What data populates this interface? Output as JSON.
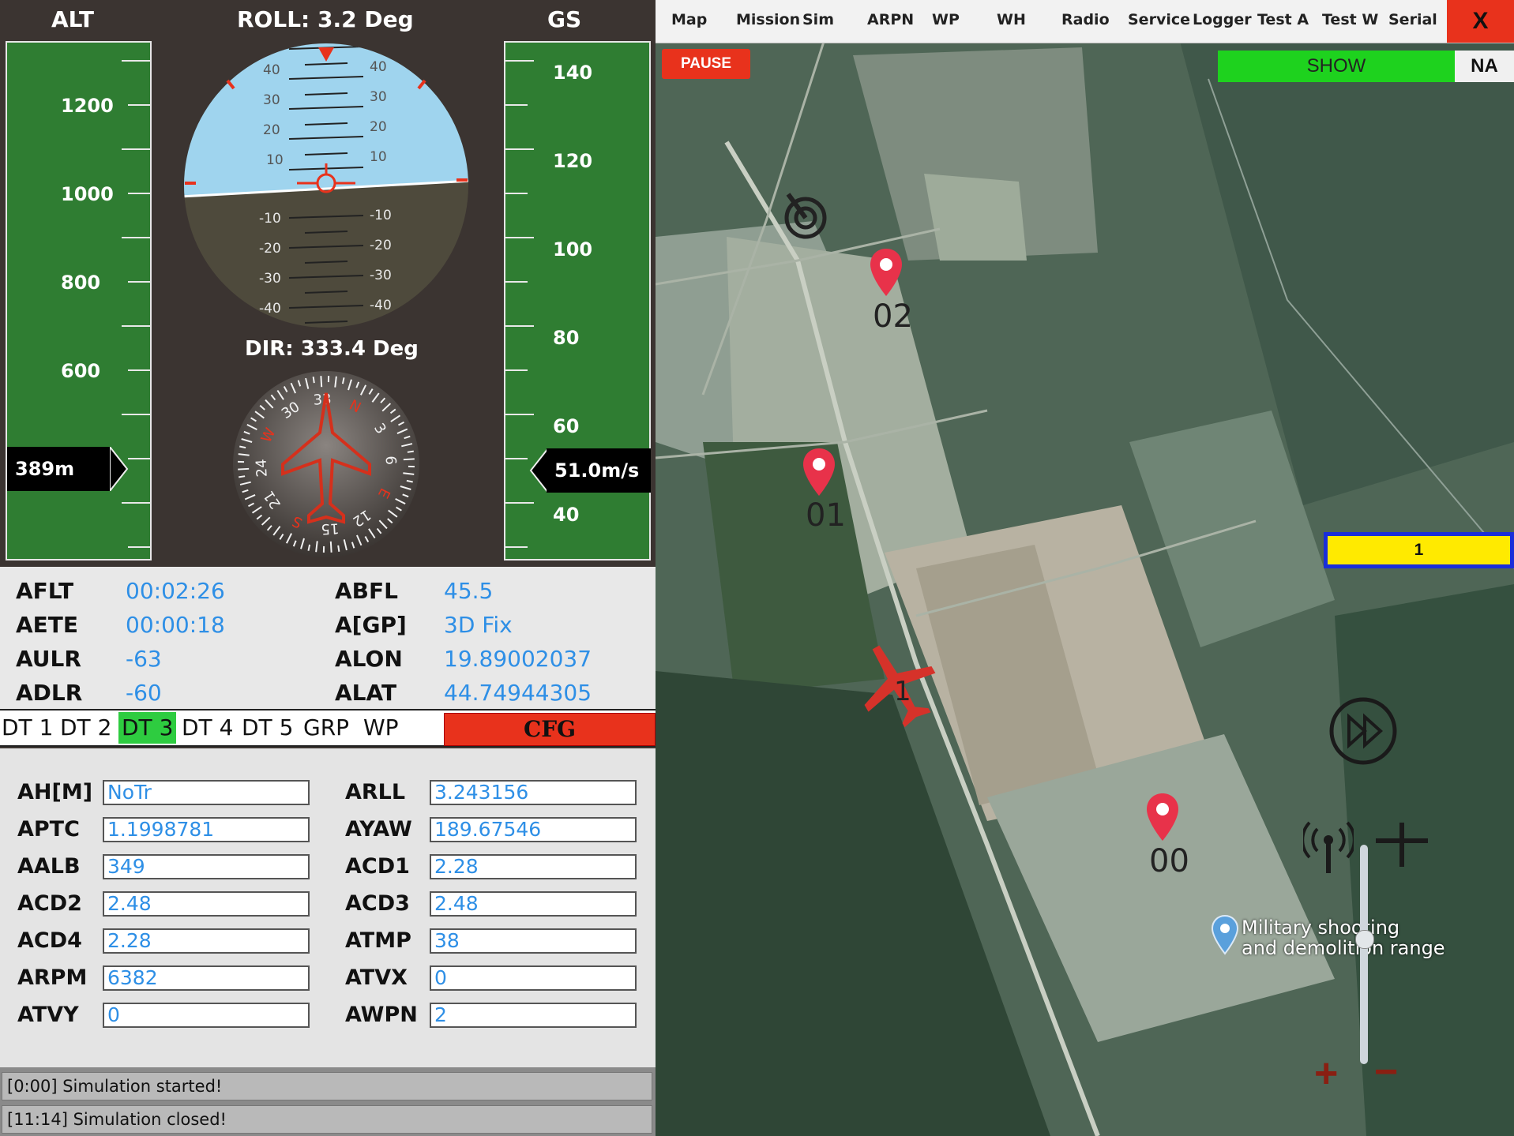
{
  "instruments": {
    "alt_header": "ALT",
    "roll": "ROLL: 3.2 Deg",
    "gs_header": "GS",
    "dir": "DIR: 333.4 Deg",
    "alt_ticks": [
      "1200",
      "1000",
      "800",
      "600"
    ],
    "alt_readout": "389m",
    "gs_ticks": [
      "140",
      "120",
      "100",
      "80",
      "60",
      "40"
    ],
    "gs_readout": "51.0m/s",
    "pitch_up": [
      "40",
      "30",
      "20",
      "10"
    ],
    "pitch_down": [
      "-10",
      "-20",
      "-30",
      "-40"
    ],
    "compass_marks": [
      "N",
      "3",
      "6",
      "E",
      "12",
      "15",
      "S",
      "21",
      "24",
      "W",
      "30",
      "33"
    ],
    "colors": {
      "tape": "#2f7d32",
      "sky": "#9fd4ee",
      "ground": "#4e4a3c",
      "accent": "#e8321c"
    }
  },
  "status": {
    "left": [
      {
        "label": "AFLT",
        "value": "00:02:26"
      },
      {
        "label": "AETE",
        "value": "00:00:18"
      },
      {
        "label": "AULR",
        "value": "-63"
      },
      {
        "label": "ADLR",
        "value": "-60"
      }
    ],
    "right": [
      {
        "label": "ABFL",
        "value": "45.5"
      },
      {
        "label": "A[GP]",
        "value": "3D Fix"
      },
      {
        "label": "ALON",
        "value": "19.89002037"
      },
      {
        "label": "ALAT",
        "value": "44.74944305"
      }
    ]
  },
  "tabs": {
    "items": [
      "DT 1",
      "DT 2",
      "DT 3",
      "DT 4",
      "DT 5",
      "GRP",
      "WP"
    ],
    "active": "DT 3",
    "cfg": "CFG"
  },
  "params": {
    "left": [
      {
        "label": "AH[M]",
        "value": "NoTr"
      },
      {
        "label": "APTC",
        "value": "1.1998781"
      },
      {
        "label": "AALB",
        "value": "349"
      },
      {
        "label": "ACD2",
        "value": "2.48"
      },
      {
        "label": "ACD4",
        "value": "2.28"
      },
      {
        "label": "ARPM",
        "value": "6382"
      },
      {
        "label": "ATVY",
        "value": "0"
      }
    ],
    "right": [
      {
        "label": "ARLL",
        "value": "3.243156"
      },
      {
        "label": "AYAW",
        "value": "189.67546"
      },
      {
        "label": "ACD1",
        "value": "2.28"
      },
      {
        "label": "ACD3",
        "value": "2.48"
      },
      {
        "label": "ATMP",
        "value": "38"
      },
      {
        "label": "ATVX",
        "value": "0"
      },
      {
        "label": "AWPN",
        "value": "2"
      }
    ]
  },
  "log": [
    "[0:00] Simulation started!",
    "[11:14] Simulation closed!"
  ],
  "menu": {
    "items": [
      "Map",
      "Mission",
      "Sim",
      "ARPN",
      "WP",
      "WH",
      "Radio",
      "Service",
      "Logger",
      "Test A",
      "Test W",
      "Serial"
    ],
    "close": "X"
  },
  "map": {
    "pause": "PAUSE",
    "show": "SHOW",
    "na": "NA",
    "aircraft_id": "1",
    "aircraft_label": "1",
    "waypoints": [
      "02",
      "01",
      "00"
    ],
    "poi_line1": "Military shooting",
    "poi_line2": "and demolition range",
    "zoom_plus": "+",
    "zoom_minus": "−"
  }
}
